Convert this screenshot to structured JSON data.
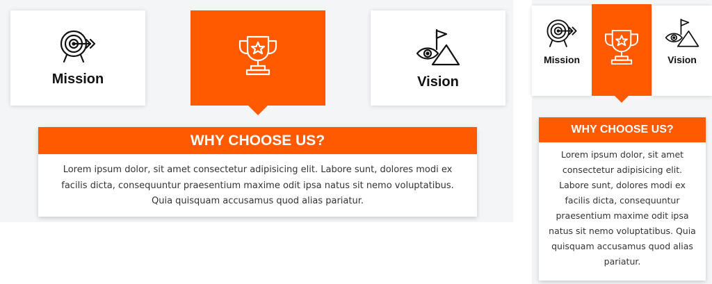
{
  "colors": {
    "accent": "#ff5a00",
    "panel_bg": "#f4f5f7",
    "card_bg": "#ffffff"
  },
  "cards": [
    {
      "label": "Mission",
      "icon": "target-icon"
    },
    {
      "label": "",
      "icon": "trophy-icon",
      "active": true
    },
    {
      "label": "Vision",
      "icon": "vision-icon"
    }
  ],
  "why": {
    "title": "WHY CHOOSE US?",
    "text": "Lorem ipsum dolor, sit amet consectetur adipisicing elit. Labore sunt, dolores modi ex facilis dicta, consequuntur praesentium maxime odit ipsa natus sit nemo voluptatibus. Quia quisquam accusamus quod alias pariatur."
  }
}
